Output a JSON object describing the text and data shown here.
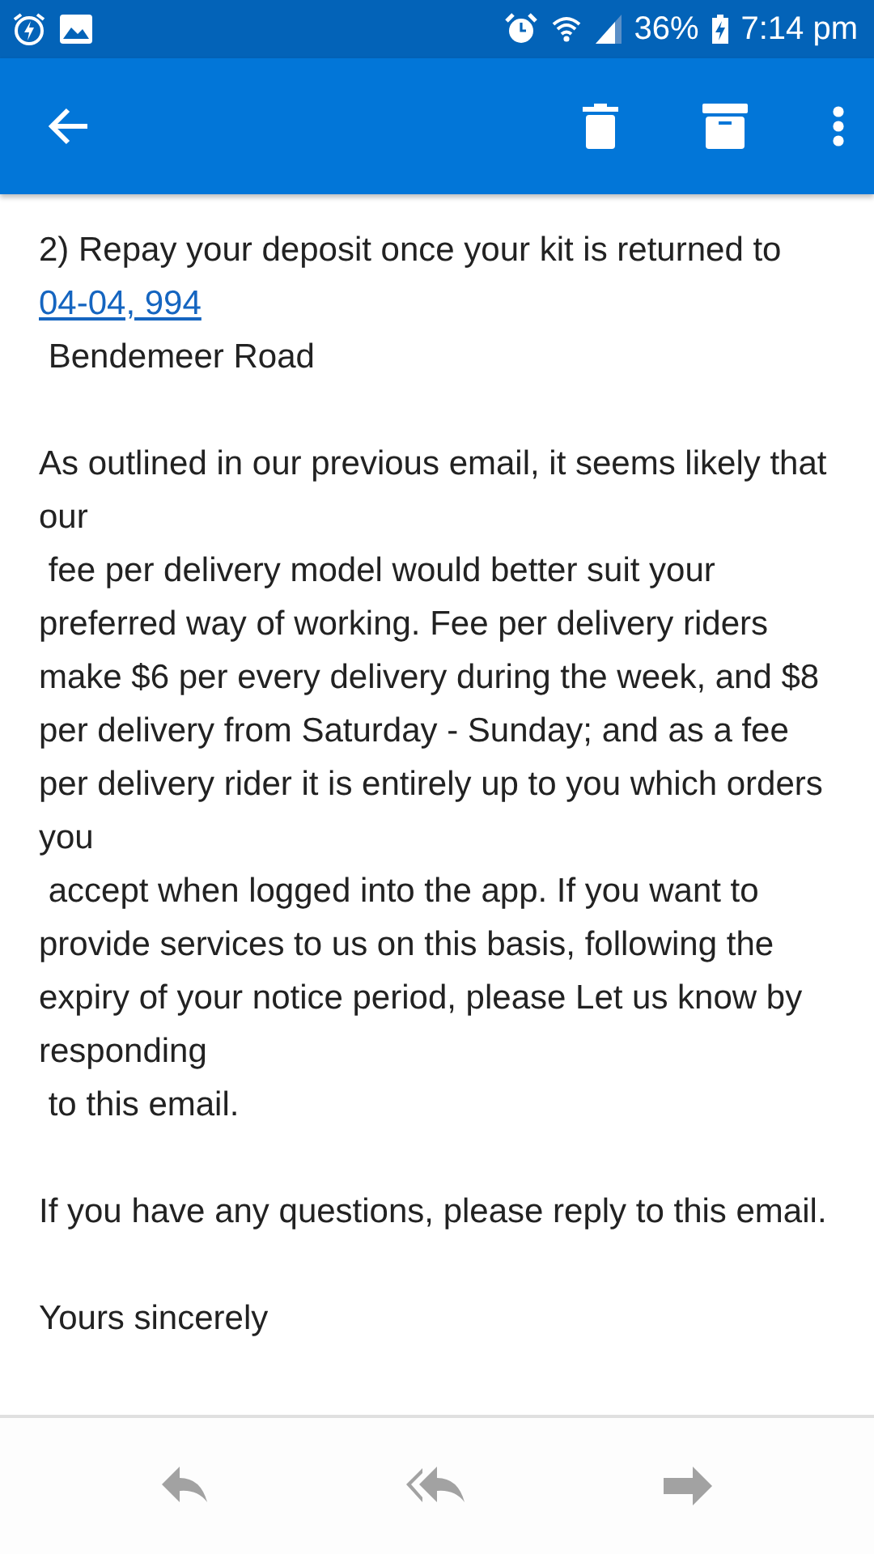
{
  "status_bar": {
    "battery": "36%",
    "time": "7:14 pm"
  },
  "message": {
    "paragraphs": [
      {
        "lines": [
          "2) Repay your deposit once your kit is returned to"
        ],
        "link": "04-04, 994",
        "after": [
          " Bendemeer Road"
        ]
      },
      {
        "lines": [
          "As outlined in our previous email, it seems likely that our",
          " fee per delivery model would better suit your preferred way of working. Fee per delivery riders make $6 per every delivery during the week, and $8 per delivery from Saturday - Sunday; and as a fee per delivery rider it is entirely up to you which orders you",
          " accept when logged into the app. If you want to provide services to us on this basis, following the expiry of your notice period, please Let us know by responding",
          " to this email."
        ]
      },
      {
        "lines": [
          "If you have any questions, please reply to this email."
        ]
      },
      {
        "lines": [
          "Yours sincerely"
        ]
      }
    ]
  }
}
